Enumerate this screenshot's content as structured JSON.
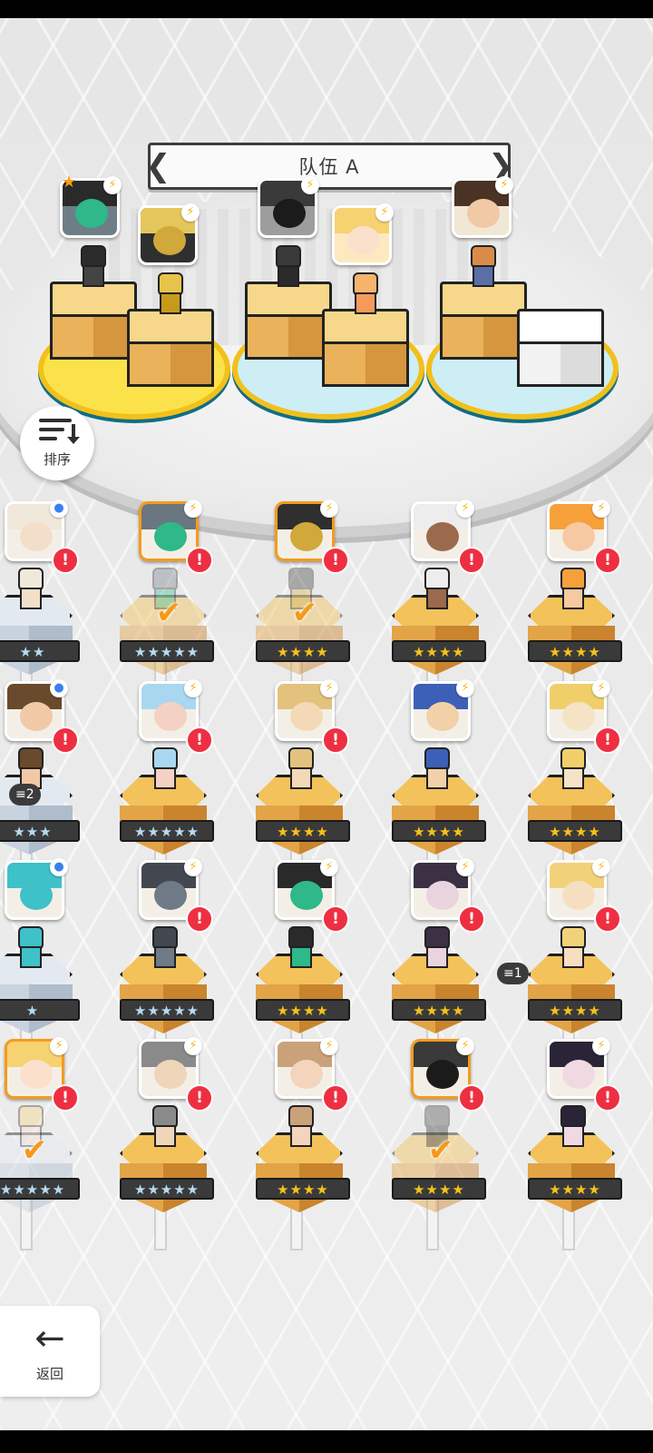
{
  "team": {
    "title": "队伍 A",
    "prev_arrow": "❮",
    "next_arrow": "❯"
  },
  "sort": {
    "label": "排序"
  },
  "back": {
    "label": "返回",
    "arrow": "←"
  },
  "colors": {
    "accent_orange": "#f49b1e",
    "alert_red": "#ee2f42",
    "pad_yellow": "#fce24a",
    "pad_blue": "#cdeef4"
  },
  "formation": [
    {
      "slot": "slot-1-left",
      "character": "green-masked-agent",
      "badge": "⚡",
      "star": "★"
    },
    {
      "slot": "slot-1-right",
      "character": "golden-armored-knight",
      "badge": "⚡"
    },
    {
      "slot": "slot-2-left",
      "character": "hooded-dark-figure",
      "badge": "⚡"
    },
    {
      "slot": "slot-2-right",
      "character": "blonde-fox-girl",
      "badge": "⚡"
    },
    {
      "slot": "slot-3-left",
      "character": "glasses-scholar",
      "badge": "⚡"
    },
    {
      "slot": "slot-3-right",
      "character": "empty"
    }
  ],
  "roster": [
    {
      "row": 1,
      "col": 0,
      "stars": "★★",
      "star_type": "silver",
      "badge": "●",
      "badge_type": "blue",
      "alert": "!",
      "selected": false,
      "ghost": false
    },
    {
      "row": 1,
      "col": 1,
      "stars": "★★★★★",
      "star_type": "silver",
      "badge": "⚡",
      "alert": "!",
      "selected": true,
      "ghost": true,
      "check": "✔"
    },
    {
      "row": 1,
      "col": 2,
      "stars": "★★★★",
      "star_type": "gold",
      "badge": "⚡",
      "alert": "!",
      "selected": true,
      "ghost": true,
      "check": "✔"
    },
    {
      "row": 1,
      "col": 3,
      "stars": "★★★★",
      "star_type": "gold",
      "badge": "⚡",
      "alert": "!",
      "selected": false,
      "ghost": false
    },
    {
      "row": 1,
      "col": 4,
      "stars": "★★★★",
      "star_type": "gold",
      "badge": "⚡",
      "alert": "!",
      "selected": false,
      "ghost": false
    },
    {
      "row": 2,
      "col": 0,
      "stars": "★★★",
      "star_type": "silver",
      "badge": "●",
      "badge_type": "blue",
      "alert": "!",
      "selected": false,
      "ghost": false,
      "tier": "≡2"
    },
    {
      "row": 2,
      "col": 1,
      "stars": "★★★★★",
      "star_type": "silver",
      "badge": "⚡",
      "alert": "!",
      "selected": false,
      "ghost": false
    },
    {
      "row": 2,
      "col": 2,
      "stars": "★★★★",
      "star_type": "gold",
      "badge": "⚡",
      "alert": "!",
      "selected": false,
      "ghost": false
    },
    {
      "row": 2,
      "col": 3,
      "stars": "★★★★",
      "star_type": "gold",
      "badge": "⚡",
      "alert": "",
      "selected": false,
      "ghost": false
    },
    {
      "row": 2,
      "col": 4,
      "stars": "★★★★",
      "star_type": "gold",
      "badge": "⚡",
      "alert": "!",
      "selected": false,
      "ghost": false
    },
    {
      "row": 3,
      "col": 0,
      "stars": "★",
      "star_type": "silver",
      "badge": "●",
      "badge_type": "blue",
      "alert": "",
      "selected": false,
      "ghost": false
    },
    {
      "row": 3,
      "col": 1,
      "stars": "★★★★★",
      "star_type": "silver",
      "badge": "⚡",
      "alert": "!",
      "selected": false,
      "ghost": false
    },
    {
      "row": 3,
      "col": 2,
      "stars": "★★★★",
      "star_type": "gold",
      "badge": "⚡",
      "alert": "!",
      "selected": false,
      "ghost": false
    },
    {
      "row": 3,
      "col": 3,
      "stars": "★★★★",
      "star_type": "gold",
      "badge": "⚡",
      "alert": "!",
      "selected": false,
      "ghost": false
    },
    {
      "row": 3,
      "col": 4,
      "stars": "★★★★",
      "star_type": "gold",
      "badge": "⚡",
      "alert": "!",
      "selected": false,
      "ghost": false,
      "tier": "≡1"
    },
    {
      "row": 4,
      "col": 0,
      "stars": "★★★★★",
      "star_type": "silver",
      "badge": "⚡",
      "alert": "!",
      "selected": true,
      "ghost": true,
      "check": "✔"
    },
    {
      "row": 4,
      "col": 1,
      "stars": "★★★★★",
      "star_type": "silver",
      "badge": "⚡",
      "alert": "!",
      "selected": false,
      "ghost": false
    },
    {
      "row": 4,
      "col": 2,
      "stars": "★★★★",
      "star_type": "gold",
      "badge": "⚡",
      "alert": "!",
      "selected": false,
      "ghost": false
    },
    {
      "row": 4,
      "col": 3,
      "stars": "★★★★",
      "star_type": "gold",
      "badge": "⚡",
      "alert": "!",
      "selected": true,
      "ghost": true,
      "check": "✔"
    },
    {
      "row": 4,
      "col": 4,
      "stars": "★★★★",
      "star_type": "gold",
      "badge": "⚡",
      "alert": "!",
      "selected": false,
      "ghost": false
    }
  ]
}
